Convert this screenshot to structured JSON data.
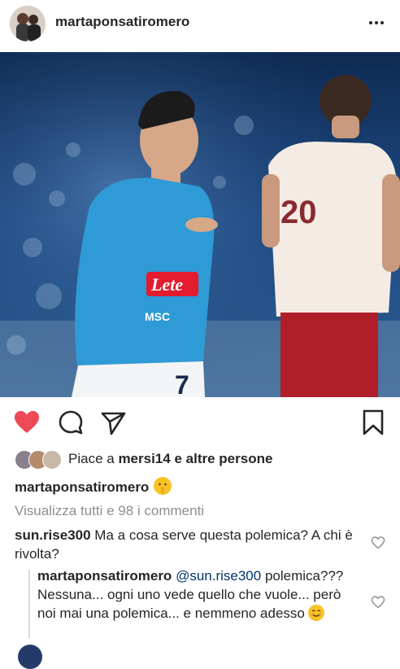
{
  "post": {
    "username": "martaponsatiromero"
  },
  "likes": {
    "prefix": "Piace a",
    "user": "mersi14",
    "connector": "e",
    "rest": "altre persone"
  },
  "caption": {
    "username": "martaponsatiromero"
  },
  "view_all_comments": "Visualizza tutti e 98 i commenti",
  "comments": [
    {
      "username": "sun.rise300",
      "text": "Ma a cosa serve questa polemica? A chi è rivolta?"
    },
    {
      "username": "martaponsatiromero",
      "mention": "@sun.rise300",
      "text": "polemica??? Nessuna... ogni uno vede quello che vuole... però noi mai una polemica... e nemmeno adesso"
    }
  ],
  "colors": {
    "like_red": "#ed4956",
    "text": "#262626",
    "muted": "#8e8e8e",
    "jersey_blue": "#2e9ad6",
    "opponent_white": "#f4ece4",
    "opponent_shorts": "#b01e2a"
  },
  "icons": [
    "more-icon",
    "heart-icon-filled",
    "comment-icon",
    "share-icon",
    "bookmark-icon",
    "comment-like-heart-icon"
  ]
}
